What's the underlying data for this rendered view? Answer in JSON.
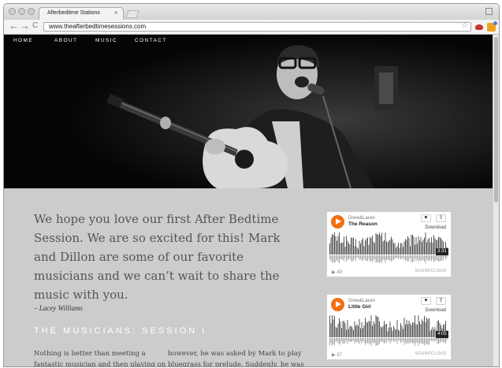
{
  "browser": {
    "tab_title": "Afterbedtime Stations",
    "tab_close": "×",
    "url": "www.theafterbedtimesessions.com",
    "back": "←",
    "forward": "→",
    "reload": "C",
    "star": "☆"
  },
  "nav": {
    "items": [
      {
        "label": "HOME"
      },
      {
        "label": "ABOUT"
      },
      {
        "label": "MUSIC"
      },
      {
        "label": "CONTACT"
      }
    ]
  },
  "intro": {
    "lines": [
      "We hope you love our first After Bedtime",
      "Session. We are so excited for this! Mark",
      "and Dillon are some of our favorite",
      "musicians and we can’t wait to share the",
      "music with you."
    ],
    "author": "– Lacey Williams"
  },
  "section": {
    "heading": "THE MUSICIANS: SESSION I"
  },
  "body": {
    "col1": [
      "Nothing is better than meeting a",
      "fantastic musician and then playing on"
    ],
    "col2": [
      "however, he was asked by Mark to play",
      "bluegrass for prelude. Suddenly, he was"
    ]
  },
  "widgets": [
    {
      "artist": "Drew&Lacev",
      "track": "The Reason",
      "duration": "3:31",
      "plays": "▶ 49",
      "download": "Download",
      "like": "♥",
      "share": "⇪",
      "brand": "SOUNDCLOUD"
    },
    {
      "artist": "Drew&Lacev",
      "track": "Little Girl",
      "duration": "4:05",
      "plays": "▶ 37",
      "download": "Download",
      "like": "♥",
      "share": "⇪",
      "brand": "SOUNDCLOUD"
    }
  ],
  "colors": {
    "accent": "#f26f10",
    "page_bg": "#cccccc",
    "hero_bg": "#0b0b0b"
  },
  "icons": [
    "play-icon",
    "heart-icon",
    "share-icon",
    "soundcloud-icon",
    "star-icon"
  ]
}
